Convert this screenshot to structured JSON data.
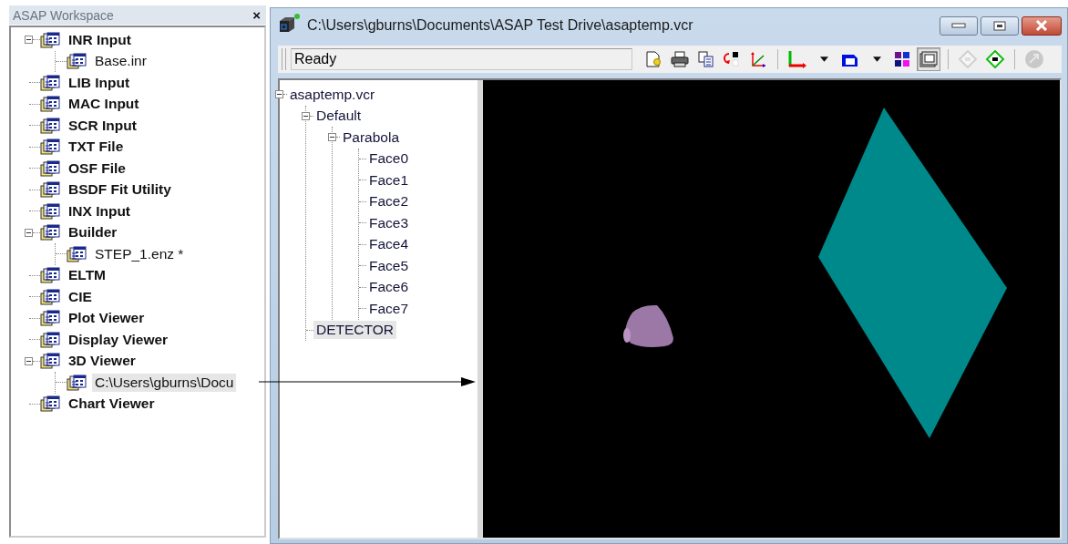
{
  "workspace": {
    "title": "ASAP Workspace",
    "close": "×",
    "items": [
      {
        "label": "INR Input",
        "selected": false,
        "expanded": true,
        "children": [
          {
            "label": "Base.inr",
            "selected": false
          }
        ]
      },
      {
        "label": "LIB Input",
        "selected": false
      },
      {
        "label": "MAC Input",
        "selected": false
      },
      {
        "label": "SCR Input",
        "selected": false
      },
      {
        "label": "TXT File",
        "selected": false
      },
      {
        "label": "OSF File",
        "selected": false
      },
      {
        "label": "BSDF Fit Utility",
        "selected": false
      },
      {
        "label": "INX Input",
        "selected": false
      },
      {
        "label": "Builder",
        "selected": false,
        "expanded": true,
        "children": [
          {
            "label": "STEP_1.enz *",
            "selected": false
          }
        ]
      },
      {
        "label": "ELTM",
        "selected": false
      },
      {
        "label": "CIE",
        "selected": false
      },
      {
        "label": "Plot Viewer",
        "selected": false
      },
      {
        "label": "Display Viewer",
        "selected": false
      },
      {
        "label": "3D Viewer",
        "selected": false,
        "expanded": true,
        "children": [
          {
            "label": "C:\\Users\\gburns\\Docu",
            "selected": true
          }
        ]
      },
      {
        "label": "Chart Viewer",
        "selected": false
      }
    ]
  },
  "window": {
    "title": "C:\\Users\\gburns\\Documents\\ASAP Test Drive\\asaptemp.vcr",
    "status": "Ready",
    "toolbar": [
      {
        "kind": "new",
        "pressed": false,
        "disabled": false
      },
      {
        "kind": "print",
        "pressed": false,
        "disabled": false
      },
      {
        "kind": "copy",
        "pressed": false,
        "disabled": false
      },
      {
        "kind": "swap",
        "pressed": false,
        "disabled": false
      },
      {
        "kind": "rotate",
        "pressed": false,
        "disabled": false
      },
      {
        "kind": "separator"
      },
      {
        "kind": "axes",
        "pressed": false,
        "disabled": false
      },
      {
        "kind": "caret",
        "pressed": false,
        "disabled": false
      },
      {
        "kind": "box",
        "pressed": false,
        "disabled": false
      },
      {
        "kind": "caret",
        "pressed": false,
        "disabled": false
      },
      {
        "kind": "colors",
        "pressed": false,
        "disabled": false
      },
      {
        "kind": "frame",
        "pressed": true,
        "disabled": false
      },
      {
        "kind": "separator"
      },
      {
        "kind": "diamond",
        "pressed": false,
        "disabled": true
      },
      {
        "kind": "diamond",
        "pressed": false,
        "disabled": false
      },
      {
        "kind": "separator"
      },
      {
        "kind": "globe",
        "pressed": false,
        "disabled": true
      }
    ],
    "tree": [
      {
        "label": "asaptemp.vcr",
        "selected": false,
        "expanded": true,
        "children": [
          {
            "label": "Default",
            "selected": false,
            "expanded": true,
            "children": [
              {
                "label": "Parabola",
                "selected": false,
                "expanded": true,
                "children": [
                  {
                    "label": "Face0",
                    "selected": false
                  },
                  {
                    "label": "Face1",
                    "selected": false
                  },
                  {
                    "label": "Face2",
                    "selected": false
                  },
                  {
                    "label": "Face3",
                    "selected": false
                  },
                  {
                    "label": "Face4",
                    "selected": false
                  },
                  {
                    "label": "Face5",
                    "selected": false
                  },
                  {
                    "label": "Face6",
                    "selected": false
                  },
                  {
                    "label": "Face7",
                    "selected": false
                  }
                ]
              }
            ]
          },
          {
            "label": "DETECTOR",
            "selected": true
          }
        ]
      }
    ]
  }
}
